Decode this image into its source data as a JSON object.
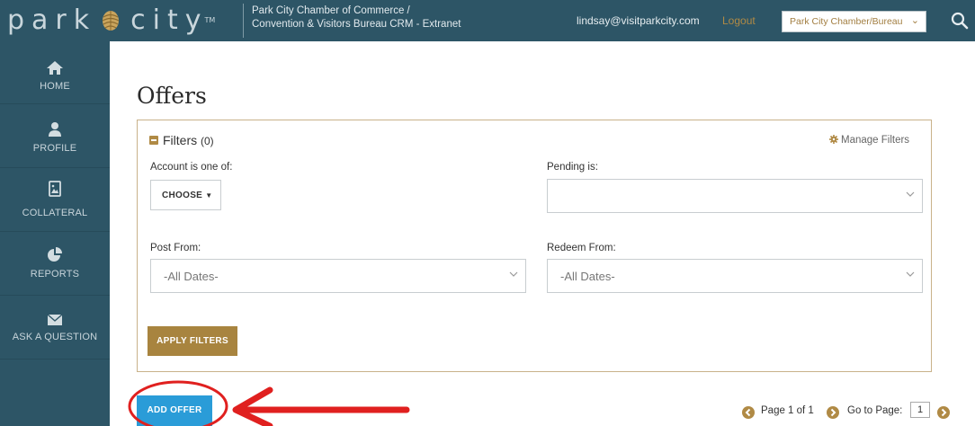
{
  "header": {
    "logo_part1": "park",
    "logo_part2": "city",
    "logo_tm": "TM",
    "org_name_line1": "Park City Chamber of Commerce /",
    "org_name_line2": "Convention & Visitors Bureau CRM - Extranet",
    "user_email": "lindsay@visitparkcity.com",
    "logout_label": "Logout",
    "org_select_value": "Park City Chamber/Bureau"
  },
  "sidebar": {
    "items": [
      {
        "label": "HOME",
        "icon": "home-icon"
      },
      {
        "label": "PROFILE",
        "icon": "user-icon"
      },
      {
        "label": "COLLATERAL",
        "icon": "image-file-icon"
      },
      {
        "label": "REPORTS",
        "icon": "pie-chart-icon"
      },
      {
        "label": "ASK A QUESTION",
        "icon": "envelope-icon"
      }
    ]
  },
  "main": {
    "page_title": "Offers",
    "filters": {
      "title": "Filters",
      "count": "(0)",
      "manage_label": "Manage Filters",
      "account_label": "Account is one of:",
      "choose_label": "CHOOSE",
      "pending_label": "Pending is:",
      "pending_value": "",
      "post_from_label": "Post From:",
      "post_from_value": "-All Dates-",
      "redeem_from_label": "Redeem From:",
      "redeem_from_value": "-All Dates-",
      "apply_label": "APPLY FILTERS"
    },
    "add_offer_label": "ADD OFFER",
    "pager": {
      "page_info": "Page 1 of 1",
      "goto_label": "Go to Page:",
      "goto_value": "1"
    }
  },
  "colors": {
    "brand_dark": "#2d5566",
    "accent_gold": "#b08a45",
    "button_blue": "#2a9cd8",
    "annotation_red": "#e0201f"
  }
}
